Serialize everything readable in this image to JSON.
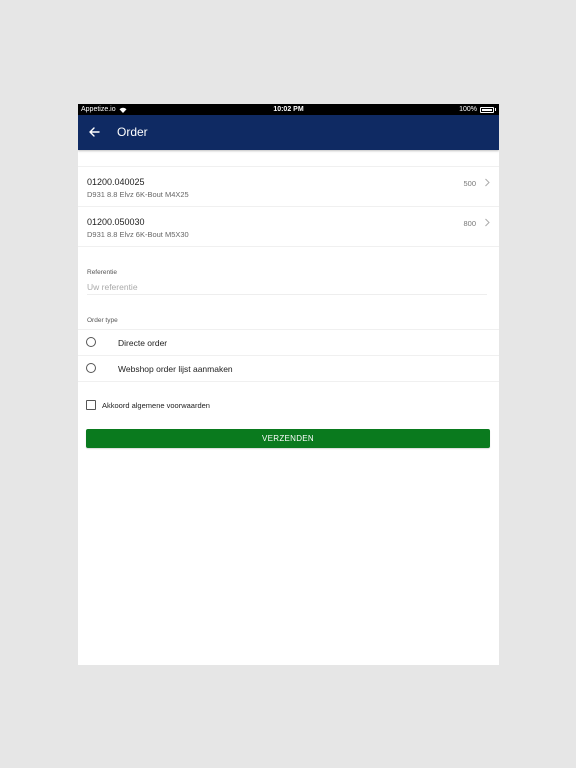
{
  "status_bar": {
    "carrier": "Appetize.io",
    "time": "10:02 PM",
    "battery": "100%"
  },
  "appbar": {
    "title": "Order",
    "back_icon": "arrow-left-icon"
  },
  "order_lines": [
    {
      "code": "01200.040025",
      "description": "D931 8.8 Elvz 6K-Bout M4X25",
      "quantity": "500"
    },
    {
      "code": "01200.050030",
      "description": "D931 8.8 Elvz 6K-Bout M5X30",
      "quantity": "800"
    }
  ],
  "reference": {
    "label": "Referentie",
    "placeholder": "Uw referentie",
    "value": ""
  },
  "order_type": {
    "label": "Order type",
    "options": [
      "Directe order",
      "Webshop order lijst aanmaken"
    ]
  },
  "terms": {
    "label": "Akkoord algemene voorwaarden"
  },
  "submit": {
    "label": "VERZENDEN"
  },
  "colors": {
    "appbar": "#0f2a63",
    "submit": "#0a7a1e",
    "background": "#e6e6e6"
  }
}
